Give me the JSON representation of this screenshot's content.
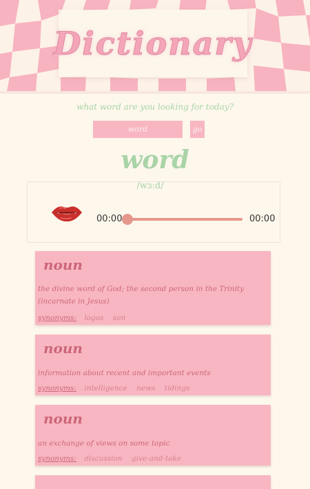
{
  "header": {
    "title": "Dictionary",
    "prompt": "what word are you looking for today?"
  },
  "search": {
    "placeholder": "word",
    "value": "",
    "go_label": "go"
  },
  "entry": {
    "word": "word",
    "phonetic": "/wɜːd/",
    "audio": {
      "current_time": "00:00",
      "duration": "00:00"
    },
    "meanings": [
      {
        "part_of_speech": "noun",
        "definition": "the divine word of God; the second person in the Trinity (incarnate in Jesus)",
        "synonyms_label": "synonyms:",
        "synonyms": [
          "logos",
          "son"
        ]
      },
      {
        "part_of_speech": "noun",
        "definition": "information about recent and important events",
        "synonyms_label": "synonyms:",
        "synonyms": [
          "intelligence",
          "news",
          "tidings"
        ]
      },
      {
        "part_of_speech": "noun",
        "definition": "an exchange of views on some topic",
        "synonyms_label": "synonyms:",
        "synonyms": [
          "discussion",
          "give-and-take"
        ]
      }
    ]
  },
  "colors": {
    "background": "#fdf7ec",
    "pink": "#f8b6c2",
    "rose_text": "#cc6679",
    "mint": "#a9d4a8",
    "slider": "#e6978c"
  },
  "icons": {
    "play": "lips-icon"
  }
}
